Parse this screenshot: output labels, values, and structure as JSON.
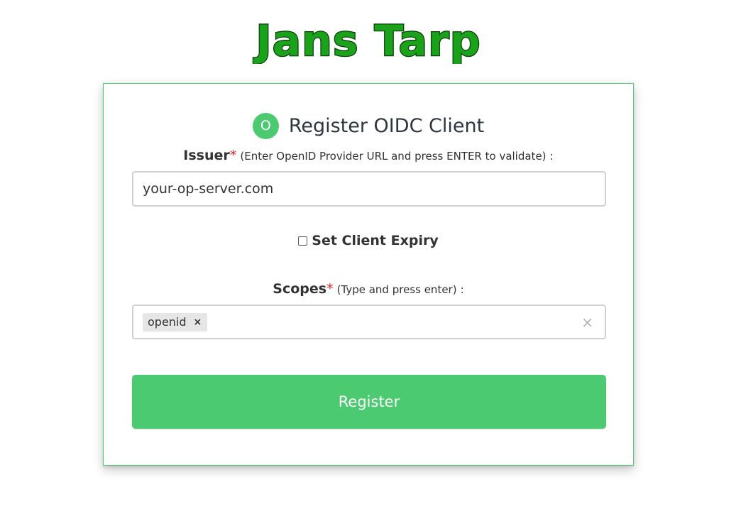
{
  "brand": {
    "logo_text": "Jans Tarp",
    "accent": "#4cca71",
    "logo_color": "#1aa31a"
  },
  "form": {
    "title": "Register OIDC Client",
    "title_icon_letter": "O",
    "issuer": {
      "label": "Issuer",
      "required_mark": "*",
      "hint": "(Enter OpenID Provider URL and press ENTER to validate)",
      "suffix": ":",
      "value": "your-op-server.com"
    },
    "expiry": {
      "label": "Set Client Expiry",
      "checked": false
    },
    "scopes": {
      "label": "Scopes",
      "required_mark": "*",
      "hint": "(Type and press enter)",
      "suffix": ":",
      "chips": [
        {
          "label": "openid",
          "remove": "×"
        }
      ],
      "clear_all": "×"
    },
    "submit_label": "Register"
  }
}
